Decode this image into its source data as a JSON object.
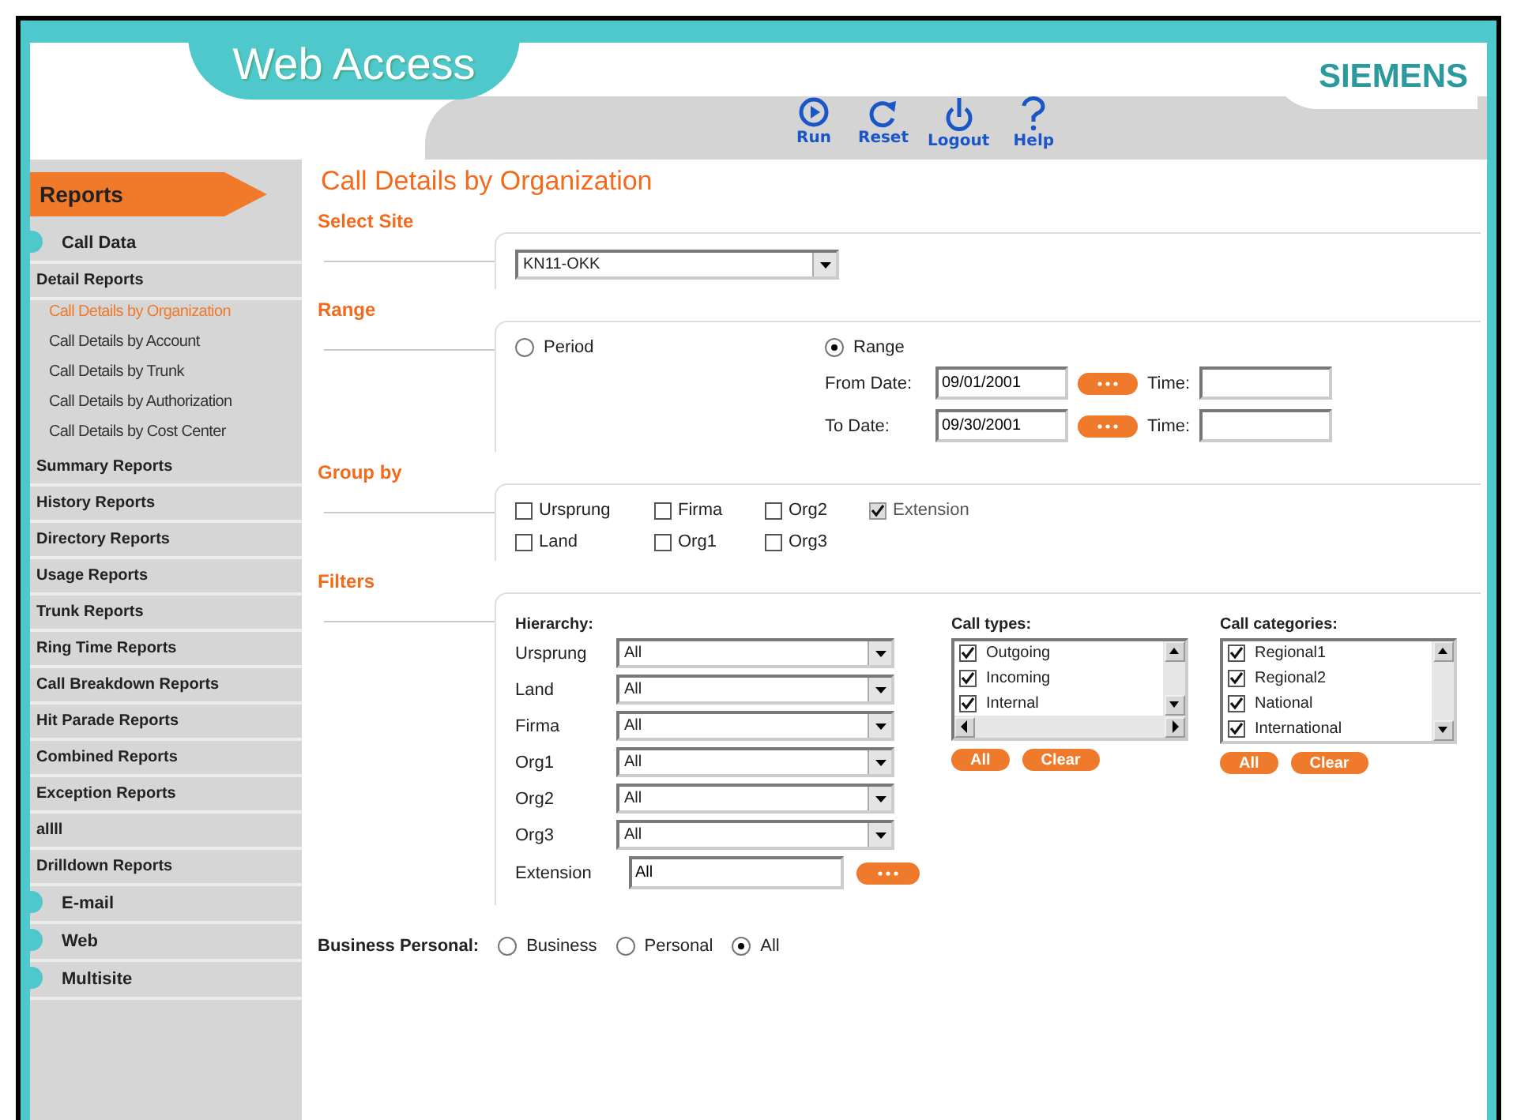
{
  "header": {
    "title": "Web Access",
    "brand": "SIEMENS",
    "toolbar": [
      {
        "label": "Run",
        "kind": "run"
      },
      {
        "label": "Reset",
        "kind": "reset"
      },
      {
        "label": "Logout",
        "kind": "logout"
      },
      {
        "label": "Help",
        "kind": "help"
      }
    ]
  },
  "sidebar": {
    "tab": "Reports",
    "items": [
      {
        "label": "Call Data",
        "kind": "section"
      },
      {
        "label": "Detail Reports",
        "kind": "group",
        "children": [
          {
            "label": "Call Details by Organization",
            "selected": true
          },
          {
            "label": "Call Details by Account",
            "selected": false
          },
          {
            "label": "Call Details by Trunk",
            "selected": false
          },
          {
            "label": "Call Details by Authorization",
            "selected": false
          },
          {
            "label": "Call Details by Cost Center",
            "selected": false
          }
        ]
      },
      {
        "label": "Summary Reports",
        "kind": "group"
      },
      {
        "label": "History Reports",
        "kind": "group"
      },
      {
        "label": "Directory Reports",
        "kind": "group"
      },
      {
        "label": "Usage Reports",
        "kind": "group"
      },
      {
        "label": "Trunk Reports",
        "kind": "group"
      },
      {
        "label": "Ring Time Reports",
        "kind": "group"
      },
      {
        "label": "Call Breakdown Reports",
        "kind": "group"
      },
      {
        "label": "Hit Parade Reports",
        "kind": "group"
      },
      {
        "label": "Combined Reports",
        "kind": "group"
      },
      {
        "label": "Exception Reports",
        "kind": "group"
      },
      {
        "label": "allll",
        "kind": "group"
      },
      {
        "label": "Drilldown Reports",
        "kind": "group"
      },
      {
        "label": "E-mail",
        "kind": "section"
      },
      {
        "label": "Web",
        "kind": "section"
      },
      {
        "label": "Multisite",
        "kind": "section"
      }
    ]
  },
  "page_title": "Call Details by Organization",
  "site": {
    "heading": "Select Site",
    "value": "KN11-OKK"
  },
  "range": {
    "heading": "Range",
    "options": [
      {
        "label": "Period",
        "selected": false
      },
      {
        "label": "Range",
        "selected": true
      }
    ],
    "dates": [
      {
        "label": "From Date:",
        "value": "09/01/2001",
        "time_label": "Time:"
      },
      {
        "label": "To Date:",
        "value": "09/30/2001",
        "time_label": "Time:"
      }
    ]
  },
  "group_by": {
    "heading": "Group by",
    "options": [
      {
        "label": "Ursprung",
        "checked": false,
        "disabled": false
      },
      {
        "label": "Firma",
        "checked": false,
        "disabled": false
      },
      {
        "label": "Org2",
        "checked": false,
        "disabled": false
      },
      {
        "label": "Extension",
        "checked": true,
        "disabled": true
      },
      {
        "label": "Land",
        "checked": false,
        "disabled": false
      },
      {
        "label": "Org1",
        "checked": false,
        "disabled": false
      },
      {
        "label": "Org3",
        "checked": false,
        "disabled": false
      }
    ]
  },
  "filters": {
    "heading": "Filters",
    "hierarchy": {
      "label": "Hierarchy:",
      "rows": [
        {
          "label": "Ursprung",
          "value": "All",
          "kind": "select"
        },
        {
          "label": "Land",
          "value": "All",
          "kind": "select"
        },
        {
          "label": "Firma",
          "value": "All",
          "kind": "select"
        },
        {
          "label": "Org1",
          "value": "All",
          "kind": "select"
        },
        {
          "label": "Org2",
          "value": "All",
          "kind": "select"
        },
        {
          "label": "Org3",
          "value": "All",
          "kind": "select"
        },
        {
          "label": "Extension",
          "value": "All",
          "kind": "text"
        }
      ]
    },
    "lists": [
      {
        "label": "Call types:",
        "hscroll": true,
        "items": [
          {
            "label": "Outgoing",
            "checked": true
          },
          {
            "label": "Incoming",
            "checked": true
          },
          {
            "label": "Internal",
            "checked": true
          }
        ],
        "buttons": [
          "All",
          "Clear"
        ]
      },
      {
        "label": "Call categories:",
        "hscroll": false,
        "items": [
          {
            "label": "Regional1",
            "checked": true
          },
          {
            "label": "Regional2",
            "checked": true
          },
          {
            "label": "National",
            "checked": true
          },
          {
            "label": "International",
            "checked": true
          }
        ],
        "buttons": [
          "All",
          "Clear"
        ]
      }
    ],
    "business_personal": {
      "label": "Business Personal:",
      "options": [
        {
          "label": "Business",
          "selected": false
        },
        {
          "label": "Personal",
          "selected": false
        },
        {
          "label": "All",
          "selected": true
        }
      ]
    }
  }
}
